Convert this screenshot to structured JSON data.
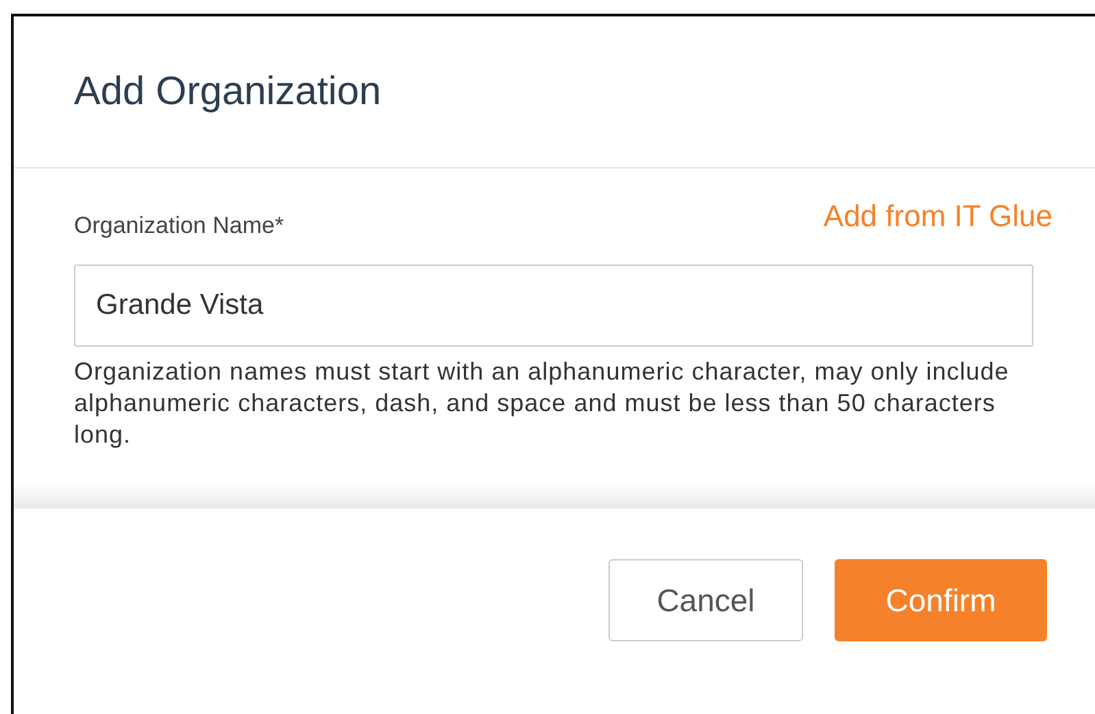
{
  "dialog": {
    "title": "Add Organization",
    "field": {
      "label": "Organization Name*",
      "value": "Grande Vista"
    },
    "link": "Add from IT Glue",
    "help": "Organization names must start with an alphanumeric character, may only include alphanumeric characters, dash, and space and must be less than 50 characters long.",
    "buttons": [
      {
        "label": "Cancel",
        "kind": "secondary"
      },
      {
        "label": "Confirm",
        "kind": "primary"
      }
    ]
  }
}
